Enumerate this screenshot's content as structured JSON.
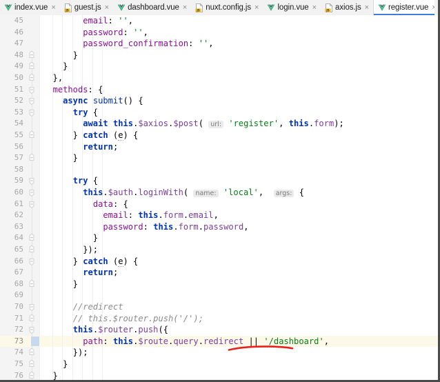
{
  "window": {
    "type": "code-editor",
    "theme": "IntelliJ Light"
  },
  "tabs": [
    {
      "label": "index.vue",
      "icon": "vue-file-icon",
      "active": false,
      "close": "×"
    },
    {
      "label": "guest.js",
      "icon": "js-file-icon",
      "active": false,
      "close": "×"
    },
    {
      "label": "dashboard.vue",
      "icon": "vue-file-icon",
      "active": false,
      "close": "×"
    },
    {
      "label": "nuxt.config.js",
      "icon": "js-file-icon",
      "active": false,
      "close": "×"
    },
    {
      "label": "login.vue",
      "icon": "vue-file-icon",
      "active": false,
      "close": "×"
    },
    {
      "label": "axios.js",
      "icon": "js-file-icon",
      "active": false,
      "close": "×"
    },
    {
      "label": "register.vue",
      "icon": "vue-file-icon",
      "active": true,
      "close": "×"
    }
  ],
  "editor": {
    "active_file": "register.vue",
    "current_line": 73,
    "first_line": 45,
    "last_line": 76,
    "colors": {
      "keyword": "#0033b3",
      "string": "#067d17",
      "property": "#871094",
      "comment": "#8c8c8c",
      "function": "#7a3e9d",
      "current_line_bg": "#fdf9e8",
      "gutter_bg": "#f4f4f4",
      "active_tab_underline": "#3b7dd8"
    },
    "lines": [
      {
        "n": 45,
        "fold": "none",
        "text": "        email: '',"
      },
      {
        "n": 46,
        "fold": "none",
        "text": "        password: '',"
      },
      {
        "n": 47,
        "fold": "none",
        "text": "        password_confirmation: '',"
      },
      {
        "n": 48,
        "fold": "end",
        "text": "      }"
      },
      {
        "n": 49,
        "fold": "end",
        "text": "    }"
      },
      {
        "n": 50,
        "fold": "end",
        "text": "  },"
      },
      {
        "n": 51,
        "fold": "start",
        "text": "  methods: {"
      },
      {
        "n": 52,
        "fold": "start",
        "text": "    async submit() {"
      },
      {
        "n": 53,
        "fold": "start",
        "text": "      try {"
      },
      {
        "n": 54,
        "fold": "none",
        "text": "        await this.$axios.$post( url: 'register', this.form);"
      },
      {
        "n": 55,
        "fold": "end",
        "text": "      } catch (e) {"
      },
      {
        "n": 56,
        "fold": "none",
        "text": "        return;"
      },
      {
        "n": 57,
        "fold": "end",
        "text": "      }"
      },
      {
        "n": 58,
        "fold": "none",
        "text": ""
      },
      {
        "n": 59,
        "fold": "start",
        "text": "      try {"
      },
      {
        "n": 60,
        "fold": "start",
        "text": "        this.$auth.loginWith( name: 'local',  args: {"
      },
      {
        "n": 61,
        "fold": "start",
        "text": "          data: {"
      },
      {
        "n": 62,
        "fold": "none",
        "text": "            email: this.form.email,"
      },
      {
        "n": 63,
        "fold": "none",
        "text": "            password: this.form.password,"
      },
      {
        "n": 64,
        "fold": "end",
        "text": "          }"
      },
      {
        "n": 65,
        "fold": "end",
        "text": "        });"
      },
      {
        "n": 66,
        "fold": "start",
        "text": "      } catch (e) {"
      },
      {
        "n": 67,
        "fold": "none",
        "text": "        return;"
      },
      {
        "n": 68,
        "fold": "end",
        "text": "      }"
      },
      {
        "n": 69,
        "fold": "none",
        "text": ""
      },
      {
        "n": 70,
        "fold": "start",
        "text": "      //redirect"
      },
      {
        "n": 71,
        "fold": "end",
        "text": "      // this.$router.push('/');"
      },
      {
        "n": 72,
        "fold": "start",
        "text": "      this.$router.push({"
      },
      {
        "n": 73,
        "fold": "none",
        "text": "        path: this.$route.query.redirect || '/dashboard',"
      },
      {
        "n": 74,
        "fold": "end",
        "text": "      });"
      },
      {
        "n": 75,
        "fold": "end",
        "text": "    }"
      },
      {
        "n": 76,
        "fold": "end",
        "text": "  }"
      }
    ],
    "inline_hints": [
      {
        "line": 54,
        "label": "url:"
      },
      {
        "line": 60,
        "label": "name:"
      },
      {
        "line": 60,
        "label": "args:"
      }
    ]
  },
  "annotation": {
    "type": "hand-drawn-underline",
    "color": "#e8211b",
    "target_text": "'/dashboard'",
    "target_line": 73
  }
}
